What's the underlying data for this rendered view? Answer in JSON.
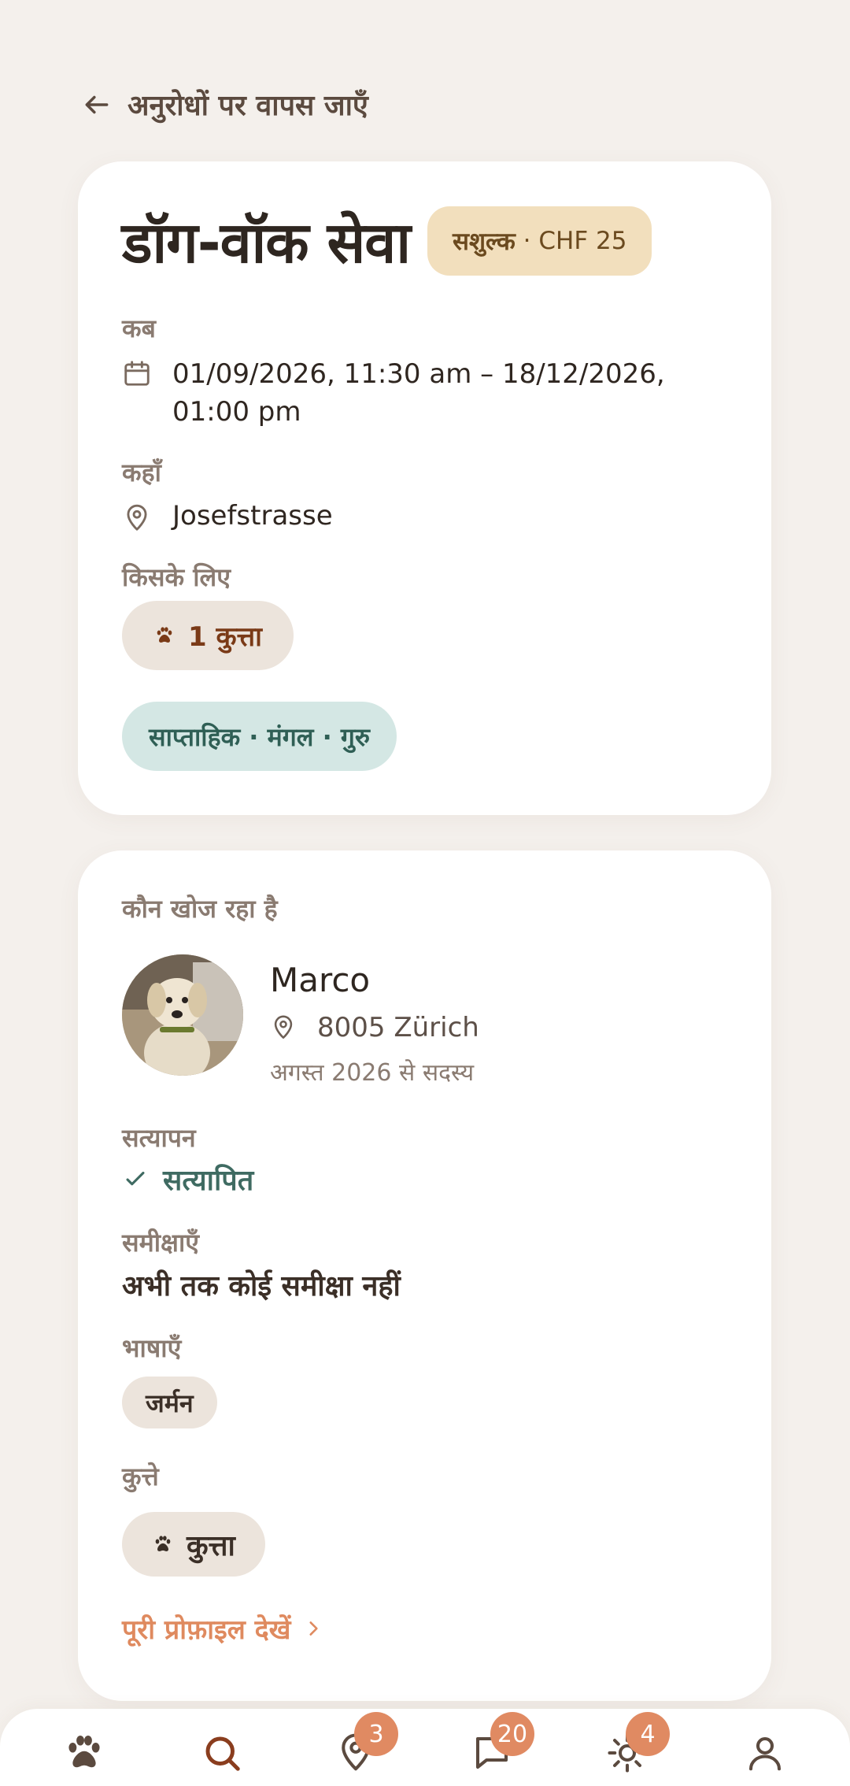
{
  "back_link": {
    "label": "अनुरोधों पर वापस जाएँ"
  },
  "request": {
    "title": "डॉग-वॉक सेवा",
    "price_kind": "सशुल्क",
    "price_sep": " · ",
    "price_amount": "CHF 25",
    "when_label": "कब",
    "when_value": "01/09/2026, 11:30 am – 18/12/2026, 01:00 pm",
    "where_label": "कहाँ",
    "where_value": "Josefstrasse",
    "for_whom_label": "किसके लिए",
    "for_whom_value": "1 कुत्ता",
    "schedule": "साप्ताहिक · मंगल · गुरु"
  },
  "requester": {
    "section_label": "कौन खोज रहा है",
    "name": "Marco",
    "location": "8005 Zürich",
    "member_since": "अगस्त 2026 से सदस्य",
    "verification_label": "सत्यापन",
    "verification_value": "सत्यापित",
    "reviews_label": "समीक्षाएँ",
    "reviews_value": "अभी तक कोई समीक्षा नहीं",
    "languages_label": "भाषाएँ",
    "languages": [
      "जर्मन"
    ],
    "dogs_label": "कुत्ते",
    "dogs": [
      "कुत्ता"
    ],
    "profile_link": "पूरी प्रोफ़ाइल देखें"
  },
  "nav": {
    "items": [
      {
        "icon": "paw-icon",
        "badge": ""
      },
      {
        "icon": "search-icon",
        "badge": ""
      },
      {
        "icon": "map-pin-icon",
        "badge": "3"
      },
      {
        "icon": "chat-icon",
        "badge": "20"
      },
      {
        "icon": "sun-icon",
        "badge": "4"
      },
      {
        "icon": "user-icon",
        "badge": ""
      }
    ]
  },
  "colors": {
    "accent": "#df8a5f",
    "badge": "#e08a62",
    "price_badge_bg": "#f2dfbd",
    "schedule_bg": "#d4e7e4",
    "verified_text": "#3f6b62"
  }
}
